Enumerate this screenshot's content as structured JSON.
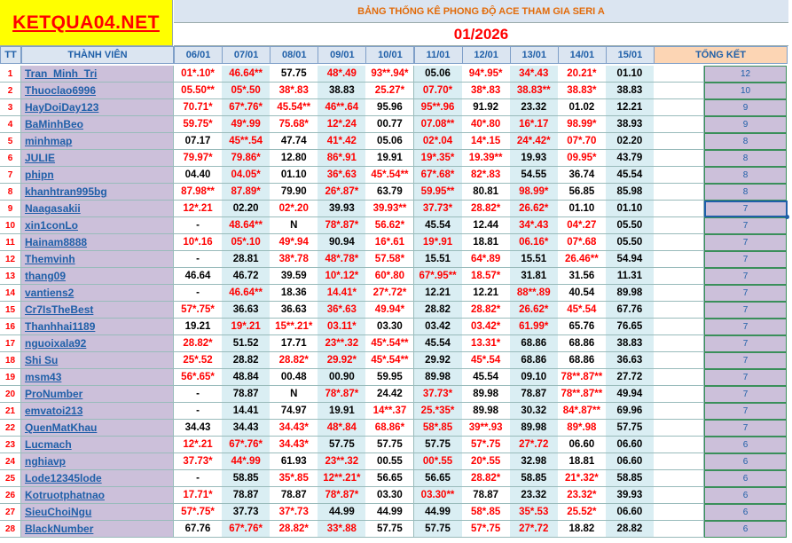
{
  "logo": "KETQUA04.NET",
  "banner": "BẢNG THỐNG KÊ PHONG ĐỘ ACE THAM GIA SERI A",
  "month": "01/2026",
  "headers": {
    "tt": "TT",
    "member": "THÀNH VIÊN",
    "dates": [
      "06/01",
      "07/01",
      "08/01",
      "09/01",
      "10/01",
      "11/01",
      "12/01",
      "13/01",
      "14/01",
      "15/01"
    ],
    "total": "TỔNG KẾT"
  },
  "colors": {
    "red": "#ff0000",
    "blue": "#1f5fa8",
    "name_bg": "#ccc0da",
    "alt_bg": "#daeef3",
    "logo_bg": "#ffff00"
  },
  "rows": [
    {
      "tt": "1",
      "name": "Tran_Minh_Tri",
      "vals": [
        "01*.10*",
        "46.64**",
        "57.75",
        "48*.49",
        "93**.94*",
        "05.06",
        "94*.95*",
        "34*.43",
        "20.21*",
        "01.10"
      ],
      "total": "12"
    },
    {
      "tt": "2",
      "name": "Thuoclao6996",
      "vals": [
        "05.50**",
        "05*.50",
        "38*.83",
        "38.83",
        "25.27*",
        "07.70*",
        "38*.83",
        "38.83**",
        "38.83*",
        "38.83"
      ],
      "total": "10"
    },
    {
      "tt": "3",
      "name": "HayDoiDay123",
      "vals": [
        "70.71*",
        "67*.76*",
        "45.54**",
        "46**.64",
        "95.96",
        "95**.96",
        "91.92",
        "23.32",
        "01.02",
        "12.21"
      ],
      "total": "9"
    },
    {
      "tt": "4",
      "name": "BaMinhBeo",
      "vals": [
        "59.75*",
        "49*.99",
        "75.68*",
        "12*.24",
        "00.77",
        "07.08**",
        "40*.80",
        "16*.17",
        "98.99*",
        "38.93"
      ],
      "total": "9"
    },
    {
      "tt": "5",
      "name": "minhmap",
      "vals": [
        "07.17",
        "45**.54",
        "47.74",
        "41*.42",
        "05.06",
        "02*.04",
        "14*.15",
        "24*.42*",
        "07*.70",
        "02.20"
      ],
      "total": "8"
    },
    {
      "tt": "6",
      "name": "JULIE",
      "vals": [
        "79.97*",
        "79.86*",
        "12.80",
        "86*.91",
        "19.91",
        "19*.35*",
        "19.39**",
        "19.93",
        "09.95*",
        "43.79"
      ],
      "total": "8"
    },
    {
      "tt": "7",
      "name": "phipn",
      "vals": [
        "04.40",
        "04.05*",
        "01.10",
        "36*.63",
        "45*.54**",
        "67*.68*",
        "82*.83",
        "54.55",
        "36.74",
        "45.54"
      ],
      "total": "8"
    },
    {
      "tt": "8",
      "name": "khanhtran995bg",
      "vals": [
        "87.98**",
        "87.89*",
        "79.90",
        "26*.87*",
        "63.79",
        "59.95**",
        "80.81",
        "98.99*",
        "56.85",
        "85.98"
      ],
      "total": "8"
    },
    {
      "tt": "9",
      "name": "Naagasakii",
      "vals": [
        "12*.21",
        "02.20",
        "02*.20",
        "39.93",
        "39.93**",
        "37.73*",
        "28.82*",
        "26.62*",
        "01.10",
        "01.10"
      ],
      "total": "7"
    },
    {
      "tt": "10",
      "name": "xin1conLo",
      "vals": [
        "-",
        "48.64**",
        "N",
        "78*.87*",
        "56.62*",
        "45.54",
        "12.44",
        "34*.43",
        "04*.27",
        "05.50"
      ],
      "total": "7"
    },
    {
      "tt": "11",
      "name": "Hainam8888",
      "vals": [
        "10*.16",
        "05*.10",
        "49*.94",
        "90.94",
        "16*.61",
        "19*.91",
        "18.81",
        "06.16*",
        "07*.68",
        "05.50"
      ],
      "total": "7"
    },
    {
      "tt": "12",
      "name": "Themvinh",
      "vals": [
        "-",
        "28.81",
        "38*.78",
        "48*.78*",
        "57.58*",
        "15.51",
        "64*.89",
        "15.51",
        "26.46**",
        "54.94"
      ],
      "total": "7"
    },
    {
      "tt": "13",
      "name": "thang09",
      "vals": [
        "46.64",
        "46.72",
        "39.59",
        "10*.12*",
        "60*.80",
        "67*.95**",
        "18.57*",
        "31.81",
        "31.56",
        "11.31"
      ],
      "total": "7"
    },
    {
      "tt": "14",
      "name": "vantiens2",
      "vals": [
        "-",
        "46.64**",
        "18.36",
        "14.41*",
        "27*.72*",
        "12.21",
        "12.21",
        "88**.89",
        "40.54",
        "89.98"
      ],
      "total": "7"
    },
    {
      "tt": "15",
      "name": "Cr7IsTheBest",
      "vals": [
        "57*.75*",
        "36.63",
        "36.63",
        "36*.63",
        "49.94*",
        "28.82",
        "28.82*",
        "26.62*",
        "45*.54",
        "67.76"
      ],
      "total": "7"
    },
    {
      "tt": "16",
      "name": "Thanhhai1189",
      "vals": [
        "19.21",
        "19*.21",
        "15**.21*",
        "03.11*",
        "03.30",
        "03.42",
        "03.42*",
        "61.99*",
        "65.76",
        "76.65"
      ],
      "total": "7"
    },
    {
      "tt": "17",
      "name": "nguoixala92",
      "vals": [
        "28.82*",
        "51.52",
        "17.71",
        "23**.32",
        "45*.54**",
        "45.54",
        "13.31*",
        "68.86",
        "68.86",
        "38.83"
      ],
      "total": "7"
    },
    {
      "tt": "18",
      "name": "Shi Su",
      "vals": [
        "25*.52",
        "28.82",
        "28.82*",
        "29.92*",
        "45*.54**",
        "29.92",
        "45*.54",
        "68.86",
        "68.86",
        "36.63"
      ],
      "total": "7"
    },
    {
      "tt": "19",
      "name": "msm43",
      "vals": [
        "56*.65*",
        "48.84",
        "00.48",
        "00.90",
        "59.95",
        "89.98",
        "45.54",
        "09.10",
        "78**.87**",
        "27.72"
      ],
      "total": "7"
    },
    {
      "tt": "20",
      "name": "ProNumber",
      "vals": [
        "-",
        "78.87",
        "N",
        "78*.87*",
        "24.42",
        "37.73*",
        "89.98",
        "78.87",
        "78**.87**",
        "49.94"
      ],
      "total": "7"
    },
    {
      "tt": "21",
      "name": "emvatoi213",
      "vals": [
        "-",
        "14.41",
        "74.97",
        "19.91",
        "14**.37",
        "25.*35*",
        "89.98",
        "30.32",
        "84*.87**",
        "69.96"
      ],
      "total": "7"
    },
    {
      "tt": "22",
      "name": "QuenMatKhau",
      "vals": [
        "34.43",
        "34.43",
        "34.43*",
        "48*.84",
        "68.86*",
        "58*.85",
        "39**.93",
        "89.98",
        "89*.98",
        "57.75"
      ],
      "total": "7"
    },
    {
      "tt": "23",
      "name": "Lucmach",
      "vals": [
        "12*.21",
        "67*.76*",
        "34.43*",
        "57.75",
        "57.75",
        "57.75",
        "57*.75",
        "27*.72",
        "06.60",
        "06.60"
      ],
      "total": "6"
    },
    {
      "tt": "24",
      "name": "nghiavp",
      "vals": [
        "37.73*",
        "44*.99",
        "61.93",
        "23**.32",
        "00.55",
        "00*.55",
        "20*.55",
        "32.98",
        "18.81",
        "06.60"
      ],
      "total": "6"
    },
    {
      "tt": "25",
      "name": "Lode12345lode",
      "vals": [
        "-",
        "58.85",
        "35*.85",
        "12**.21*",
        "56.65",
        "56.65",
        "28.82*",
        "58.85",
        "21*.32*",
        "58.85"
      ],
      "total": "6"
    },
    {
      "tt": "26",
      "name": "Kotruotphatnao",
      "vals": [
        "17.71*",
        "78.87",
        "78.87",
        "78*.87*",
        "03.30",
        "03.30**",
        "78.87",
        "23.32",
        "23.32*",
        "39.93"
      ],
      "total": "6"
    },
    {
      "tt": "27",
      "name": "SieuChoiNgu",
      "vals": [
        "57*.75*",
        "37.73",
        "37*.73",
        "44.99",
        "44.99",
        "44.99",
        "58*.85",
        "35*.53",
        "25.52*",
        "06.60"
      ],
      "total": "6"
    },
    {
      "tt": "28",
      "name": "BlackNumber",
      "vals": [
        "67.76",
        "67*.76*",
        "28.82*",
        "33*.88",
        "57.75",
        "57.75",
        "57*.75",
        "27*.72",
        "18.82",
        "28.82"
      ],
      "total": "6"
    }
  ]
}
